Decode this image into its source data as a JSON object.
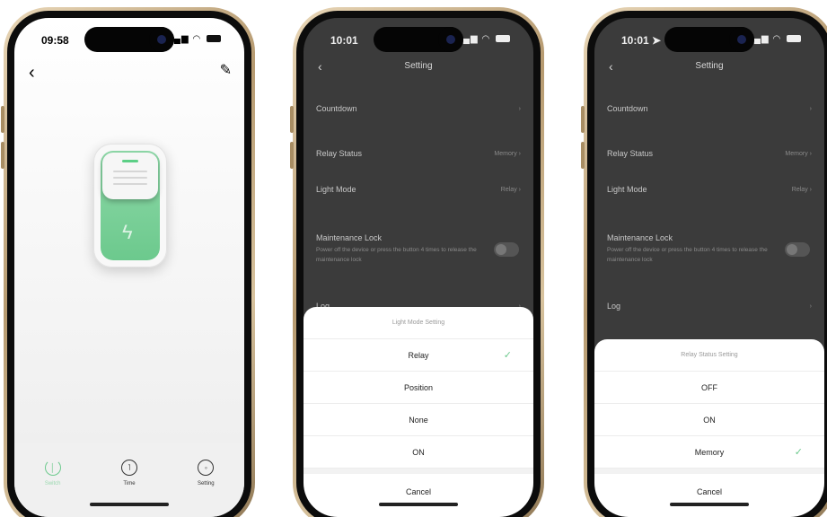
{
  "phone1": {
    "time": "09:58",
    "tabs": [
      {
        "label": "Switch",
        "icon": "power-icon"
      },
      {
        "label": "Time",
        "icon": "clock-icon"
      },
      {
        "label": "Setting",
        "icon": "gear-icon"
      }
    ]
  },
  "phone2": {
    "time": "10:01",
    "title": "Setting",
    "rows": {
      "countdown": "Countdown",
      "relay_status": "Relay Status",
      "relay_status_value": "Memory",
      "light_mode": "Light Mode",
      "light_mode_value": "Relay",
      "maintenance_lock": "Maintenance Lock",
      "maintenance_desc": "Power off the device or press the button 4 times to release the maintenance lock",
      "log": "Log"
    },
    "sheet": {
      "title": "Light Mode Setting",
      "options": [
        "Relay",
        "Position",
        "None",
        "ON"
      ],
      "selected": "Relay",
      "cancel": "Cancel"
    }
  },
  "phone3": {
    "time": "10:01",
    "title": "Setting",
    "rows": {
      "countdown": "Countdown",
      "relay_status": "Relay Status",
      "relay_status_value": "Memory",
      "light_mode": "Light Mode",
      "light_mode_value": "Relay",
      "maintenance_lock": "Maintenance Lock",
      "maintenance_desc": "Power off the device or press the button 4 times to release the maintenance lock",
      "log": "Log"
    },
    "sheet": {
      "title": "Relay Status Setting",
      "options": [
        "OFF",
        "ON",
        "Memory"
      ],
      "selected": "Memory",
      "cancel": "Cancel"
    }
  },
  "colors": {
    "accent_green": "#6cc98d",
    "overlay_dark": "#3b3b3b"
  }
}
